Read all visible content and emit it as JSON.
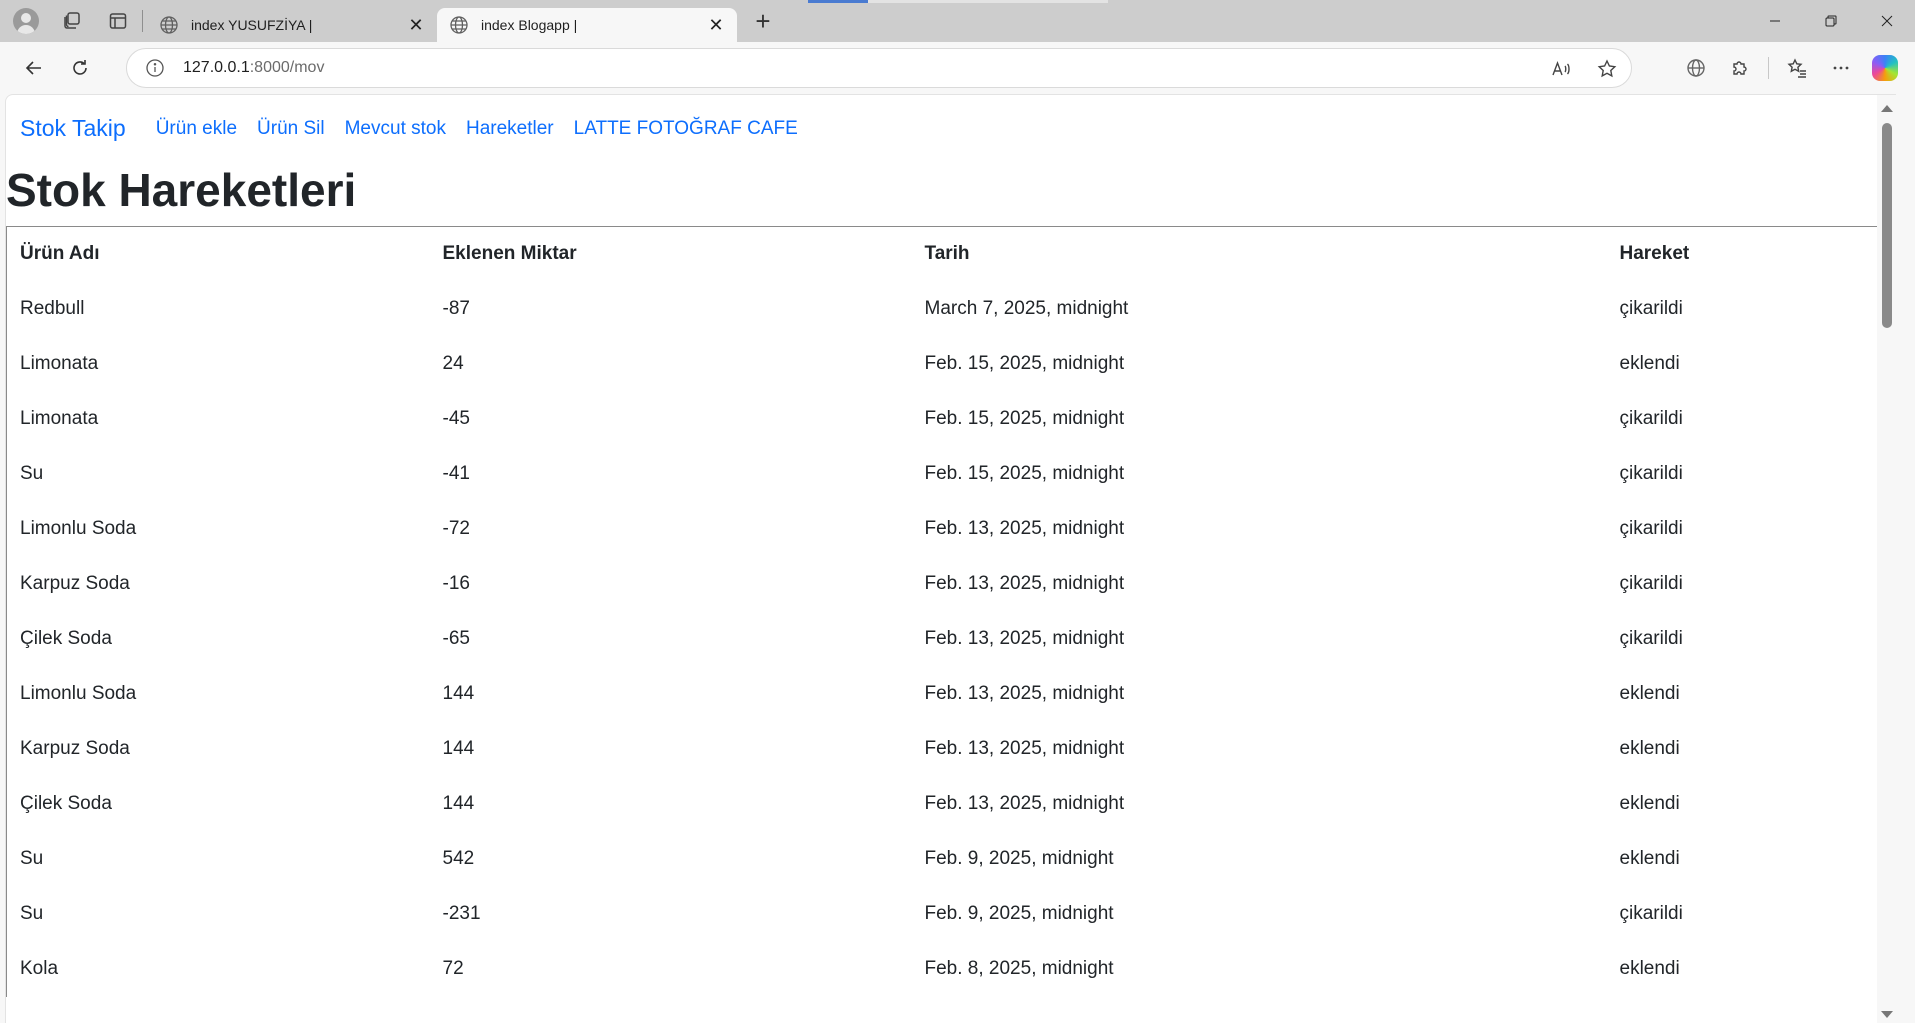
{
  "browser": {
    "tabs": [
      {
        "title": "index YUSUFZİYA |",
        "active": false
      },
      {
        "title": "index Blogapp |",
        "active": true
      }
    ],
    "address": {
      "host": "127.0.0.1",
      "path": ":8000/mov"
    }
  },
  "icons": {
    "profile": "profile-icon",
    "workspaces": "workspaces-icon",
    "tab_actions": "tab-actions-icon",
    "back": "back-arrow-icon",
    "refresh": "refresh-icon",
    "info": "info-icon",
    "read_aloud": "read-aloud-icon",
    "favorite": "star-icon",
    "browser_essentials": "globe-icon",
    "extensions": "puzzle-icon",
    "favorites": "favorites-list-icon",
    "more": "more-icon",
    "copilot": "copilot-icon"
  },
  "nav": {
    "brand": "Stok Takip",
    "links": [
      "Ürün ekle",
      "Ürün Sil",
      "Mevcut stok",
      "Hareketler",
      "LATTE FOTOĞRAF CAFE"
    ]
  },
  "page": {
    "title": "Stok Hareketleri"
  },
  "table": {
    "headers": [
      "Ürün Adı",
      "Eklenen Miktar",
      "Tarih",
      "Hareket"
    ],
    "rows": [
      [
        "Redbull",
        "-87",
        "March 7, 2025, midnight",
        "çikarildi"
      ],
      [
        "Limonata",
        "24",
        "Feb. 15, 2025, midnight",
        "eklendi"
      ],
      [
        "Limonata",
        "-45",
        "Feb. 15, 2025, midnight",
        "çikarildi"
      ],
      [
        "Su",
        "-41",
        "Feb. 15, 2025, midnight",
        "çikarildi"
      ],
      [
        "Limonlu Soda",
        "-72",
        "Feb. 13, 2025, midnight",
        "çikarildi"
      ],
      [
        "Karpuz Soda",
        "-16",
        "Feb. 13, 2025, midnight",
        "çikarildi"
      ],
      [
        "Çilek Soda",
        "-65",
        "Feb. 13, 2025, midnight",
        "çikarildi"
      ],
      [
        "Limonlu Soda",
        "144",
        "Feb. 13, 2025, midnight",
        "eklendi"
      ],
      [
        "Karpuz Soda",
        "144",
        "Feb. 13, 2025, midnight",
        "eklendi"
      ],
      [
        "Çilek Soda",
        "144",
        "Feb. 13, 2025, midnight",
        "eklendi"
      ],
      [
        "Su",
        "542",
        "Feb. 9, 2025, midnight",
        "eklendi"
      ],
      [
        "Su",
        "-231",
        "Feb. 9, 2025, midnight",
        "çikarildi"
      ],
      [
        "Kola",
        "72",
        "Feb. 8, 2025, midnight",
        "eklendi"
      ]
    ]
  },
  "colors": {
    "link": "#0d6efd",
    "text": "#212529",
    "tabstrip": "#cdcdcd"
  }
}
